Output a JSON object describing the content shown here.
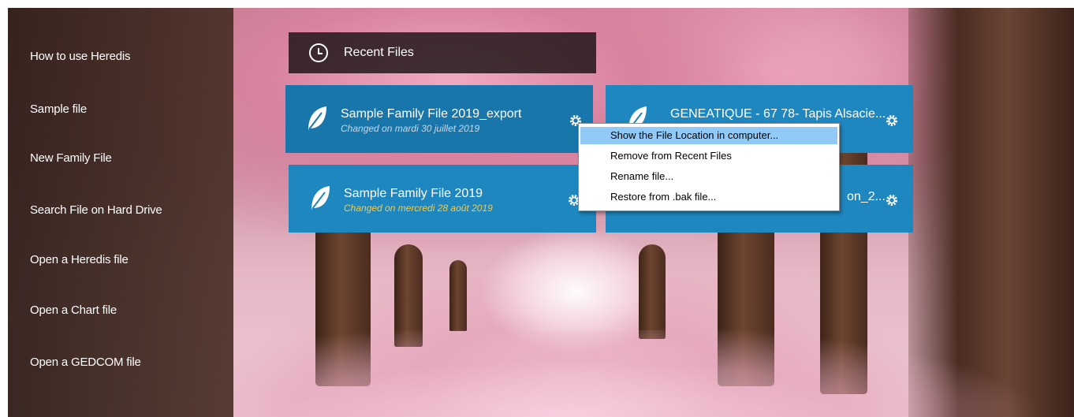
{
  "sidebar": {
    "items": [
      {
        "label": "How to use Heredis"
      },
      {
        "label": "Sample file"
      },
      {
        "label": "New Family File"
      },
      {
        "label": "Search File on Hard Drive"
      },
      {
        "label": "Open a Heredis file"
      },
      {
        "label": "Open a Chart file"
      },
      {
        "label": "Open a GEDCOM file"
      }
    ]
  },
  "recent": {
    "title": "Recent Files",
    "icon": "clock-icon",
    "files": [
      {
        "name": "Sample Family File 2019_export",
        "date": "Changed on mardi 30 juillet 2019"
      },
      {
        "name": "GENEATIQUE - 67 78- Tapis Alsacie...",
        "date": ""
      },
      {
        "name": "Sample Family File 2019",
        "date": "Changed on mercredi 28 août 2019"
      },
      {
        "name": "on_2...",
        "date": ""
      }
    ]
  },
  "context_menu": {
    "items": [
      {
        "label": "Show the File Location in computer..."
      },
      {
        "label": "Remove from Recent Files"
      },
      {
        "label": "Rename file..."
      },
      {
        "label": "Restore from .bak file..."
      }
    ]
  },
  "colors": {
    "card_blue": "#1f87bf",
    "card_active": "#1976ab",
    "date_gray": "#c8d8e8",
    "date_yellow": "#f2c94c",
    "menu_highlight": "#91c9f7"
  }
}
